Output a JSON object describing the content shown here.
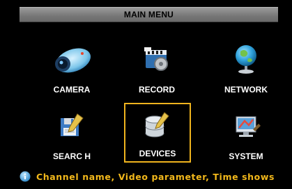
{
  "menu": {
    "title": "MAIN MENU",
    "items": [
      {
        "label": "CAMERA",
        "icon": "camera-icon"
      },
      {
        "label": "RECORD",
        "icon": "record-icon"
      },
      {
        "label": "NETWORK",
        "icon": "network-globe-icon"
      },
      {
        "label": "SEARC H",
        "icon": "search-floppy-icon"
      },
      {
        "label": "DEVICES",
        "icon": "devices-disk-icon",
        "selected": true
      },
      {
        "label": "SYSTEM",
        "icon": "system-settings-icon"
      }
    ]
  },
  "status": {
    "icon": "info-icon",
    "message": "Channel name, Video parameter, Time shows"
  },
  "colors": {
    "highlight": "#f0b41e",
    "status_text": "#f2b81b",
    "title_bar": "#8a8a8a",
    "background": "#000000"
  }
}
